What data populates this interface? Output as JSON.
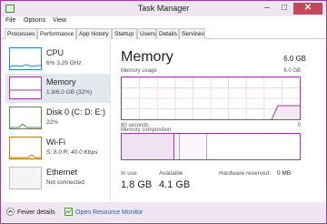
{
  "window": {
    "title": "Task Manager"
  },
  "menu": [
    "File",
    "Options",
    "View"
  ],
  "tabs": [
    "Processes",
    "Performance",
    "App history",
    "Startup",
    "Users",
    "Details",
    "Services"
  ],
  "sidebar": {
    "items": [
      {
        "title": "CPU",
        "sub": "6% 3.29 GHz"
      },
      {
        "title": "Memory",
        "sub": "1.9/6.0 GB (32%)"
      },
      {
        "title": "Disk 0 (C: D: E:)",
        "sub": "22%"
      },
      {
        "title": "Wi-Fi",
        "sub": "S: 8.0 R: 40.0 Kbps"
      },
      {
        "title": "Ethernet",
        "sub": "Not connected"
      }
    ]
  },
  "main": {
    "title": "Memory",
    "total": "6.0 GB",
    "usage_label": "Memory usage",
    "usage_max": "6.0 GB",
    "time_left": "60 seconds",
    "time_right": "0",
    "composition_label": "Memory composition",
    "in_use_label": "In use",
    "in_use_value": "1.8 GB",
    "available_label": "Available",
    "available_value": "4.1 GB",
    "hw_reserved_label": "Hardware reserved:",
    "hw_reserved_value": "0 MB"
  },
  "footer": {
    "fewer_details": "Fewer details",
    "open_monitor": "Open Resource Monitor"
  },
  "colors": {
    "memory_accent": "#9b3aa8",
    "cpu_accent": "#2f7fbf",
    "disk_accent": "#4c9a2a",
    "wifi_accent": "#c07a1a",
    "link": "#1a5fb4"
  }
}
